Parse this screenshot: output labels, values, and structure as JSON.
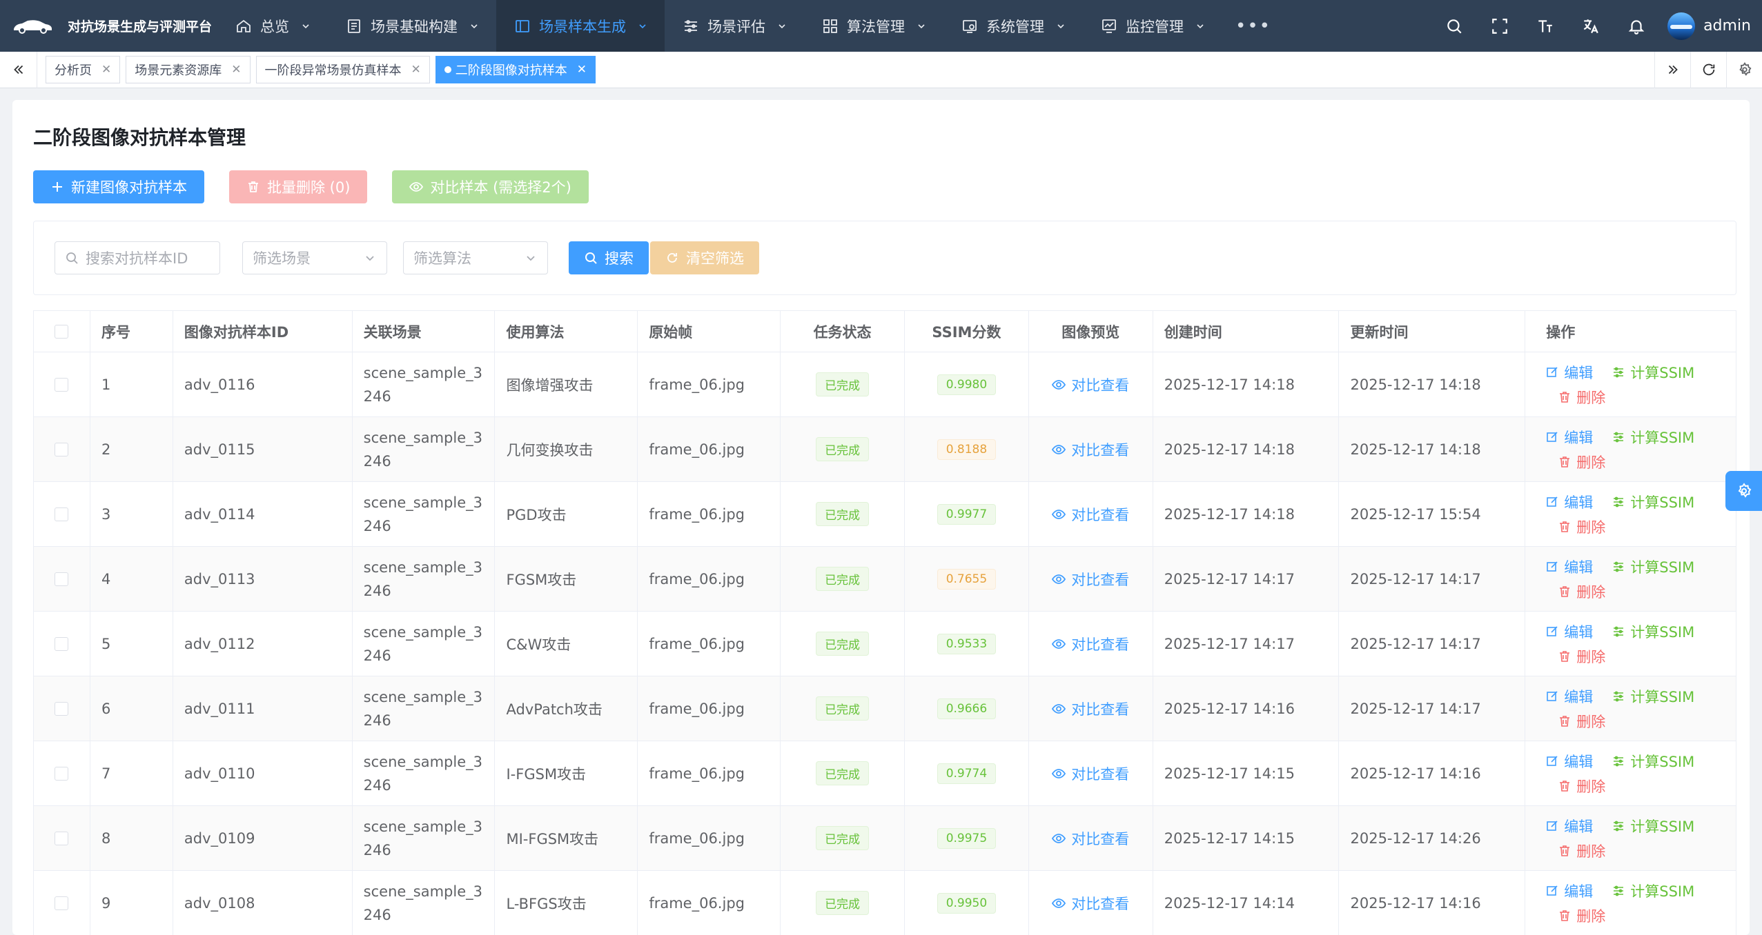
{
  "app": {
    "title": "对抗场景生成与评测平台"
  },
  "nav": {
    "items": [
      {
        "label": "总览",
        "icon": "home-icon"
      },
      {
        "label": "场景基础构建",
        "icon": "monitor-icon"
      },
      {
        "label": "场景样本生成",
        "icon": "window-icon",
        "active": true
      },
      {
        "label": "场景评估",
        "icon": "sliders-icon"
      },
      {
        "label": "算法管理",
        "icon": "grid-icon"
      },
      {
        "label": "系统管理",
        "icon": "system-icon"
      },
      {
        "label": "监控管理",
        "icon": "chart-icon"
      }
    ],
    "more": "•••",
    "user": "admin"
  },
  "tags": [
    {
      "label": "分析页"
    },
    {
      "label": "场景元素资源库"
    },
    {
      "label": "一阶段异常场景仿真样本"
    },
    {
      "label": "二阶段图像对抗样本",
      "active": true
    }
  ],
  "page": {
    "title": "二阶段图像对抗样本管理",
    "buttons": {
      "create": "新建图像对抗样本",
      "batch_delete": "批量删除 (0)",
      "compare": "对比样本 (需选择2个)"
    },
    "filter": {
      "search_placeholder": "搜索对抗样本ID",
      "scene_placeholder": "筛选场景",
      "algo_placeholder": "筛选算法",
      "search_btn": "搜索",
      "clear_btn": "清空筛选"
    }
  },
  "table": {
    "headers": [
      "序号",
      "图像对抗样本ID",
      "关联场景",
      "使用算法",
      "原始帧",
      "任务状态",
      "SSIM分数",
      "图像预览",
      "创建时间",
      "更新时间",
      "操作"
    ],
    "actions": {
      "edit": "编辑",
      "ssim": "计算SSIM",
      "delete": "删除",
      "view": "对比查看"
    },
    "rows": [
      {
        "idx": "1",
        "id": "adv_0116",
        "scene": "scene_sample_3246",
        "algo": "图像增强攻击",
        "frame": "frame_06.jpg",
        "status": "已完成",
        "ssim": "0.9980",
        "ssim_level": "ok",
        "created": "2025-12-17 14:18",
        "updated": "2025-12-17 14:18"
      },
      {
        "idx": "2",
        "id": "adv_0115",
        "scene": "scene_sample_3246",
        "algo": "几何变换攻击",
        "frame": "frame_06.jpg",
        "status": "已完成",
        "ssim": "0.8188",
        "ssim_level": "warn",
        "created": "2025-12-17 14:18",
        "updated": "2025-12-17 14:18"
      },
      {
        "idx": "3",
        "id": "adv_0114",
        "scene": "scene_sample_3246",
        "algo": "PGD攻击",
        "frame": "frame_06.jpg",
        "status": "已完成",
        "ssim": "0.9977",
        "ssim_level": "ok",
        "created": "2025-12-17 14:18",
        "updated": "2025-12-17 15:54"
      },
      {
        "idx": "4",
        "id": "adv_0113",
        "scene": "scene_sample_3246",
        "algo": "FGSM攻击",
        "frame": "frame_06.jpg",
        "status": "已完成",
        "ssim": "0.7655",
        "ssim_level": "warn",
        "created": "2025-12-17 14:17",
        "updated": "2025-12-17 14:17"
      },
      {
        "idx": "5",
        "id": "adv_0112",
        "scene": "scene_sample_3246",
        "algo": "C&W攻击",
        "frame": "frame_06.jpg",
        "status": "已完成",
        "ssim": "0.9533",
        "ssim_level": "ok",
        "created": "2025-12-17 14:17",
        "updated": "2025-12-17 14:17"
      },
      {
        "idx": "6",
        "id": "adv_0111",
        "scene": "scene_sample_3246",
        "algo": "AdvPatch攻击",
        "frame": "frame_06.jpg",
        "status": "已完成",
        "ssim": "0.9666",
        "ssim_level": "ok",
        "created": "2025-12-17 14:16",
        "updated": "2025-12-17 14:17"
      },
      {
        "idx": "7",
        "id": "adv_0110",
        "scene": "scene_sample_3246",
        "algo": "I-FGSM攻击",
        "frame": "frame_06.jpg",
        "status": "已完成",
        "ssim": "0.9774",
        "ssim_level": "ok",
        "created": "2025-12-17 14:15",
        "updated": "2025-12-17 14:16"
      },
      {
        "idx": "8",
        "id": "adv_0109",
        "scene": "scene_sample_3246",
        "algo": "MI-FGSM攻击",
        "frame": "frame_06.jpg",
        "status": "已完成",
        "ssim": "0.9975",
        "ssim_level": "ok",
        "created": "2025-12-17 14:15",
        "updated": "2025-12-17 14:26"
      },
      {
        "idx": "9",
        "id": "adv_0108",
        "scene": "scene_sample_3246",
        "algo": "L-BFGS攻击",
        "frame": "frame_06.jpg",
        "status": "已完成",
        "ssim": "0.9950",
        "ssim_level": "ok",
        "created": "2025-12-17 14:14",
        "updated": "2025-12-17 14:16"
      }
    ]
  },
  "colors": {
    "nav_bg": "#304156",
    "primary": "#409eff",
    "success": "#67c23a",
    "warning": "#e6a23c",
    "danger": "#f56c6c"
  }
}
